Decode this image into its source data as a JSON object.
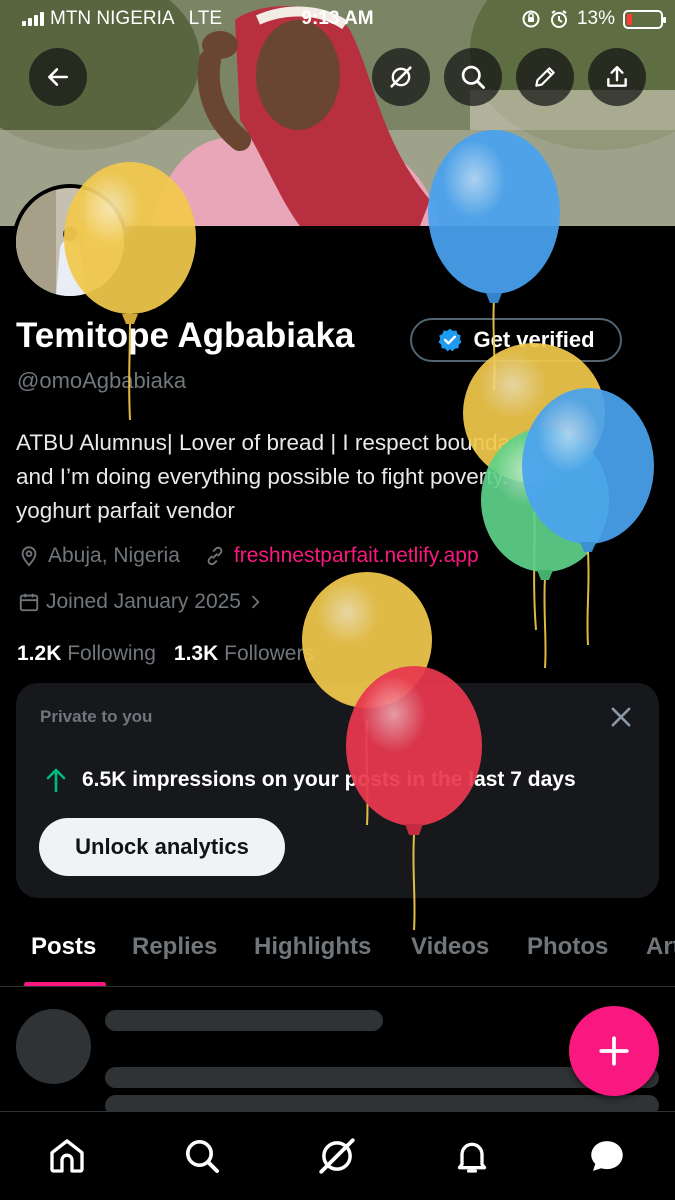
{
  "status_bar": {
    "carrier": "MTN NIGERIA",
    "network": "LTE",
    "time": "9:13 AM",
    "battery": "13%",
    "battery_level": 0.13
  },
  "profile": {
    "name": "Temitope Agbabiaka",
    "verify_label": "Get verified",
    "handle": "@omoAgbabiaka",
    "bio_lines": [
      "ATBU Alumnus| Lover of bread | I respect boundaries,",
      "and I’m doing everything possible to fight poverty.",
      "yoghurt parfait vendor"
    ],
    "location": "Abuja, Nigeria",
    "website": "freshnestparfait.netlify.app",
    "joined": "Joined January 2025",
    "following_count": "1.2K",
    "following_label": "Following",
    "followers_count": "1.3K",
    "followers_label": "Followers"
  },
  "insights": {
    "header": "Private to you",
    "impressions": "6.5K impressions on your posts in the last 7 days",
    "unlock_label": "Unlock analytics"
  },
  "tabs": [
    "Posts",
    "Replies",
    "Highlights",
    "Videos",
    "Photos",
    "Articles"
  ],
  "colors": {
    "accent": "#f91880",
    "verified": "#1d9bf0",
    "growth": "#00ba7c",
    "balloon_yellow": "#f2c94c",
    "balloon_blue": "#4aa3f0",
    "balloon_green": "#5fd38a",
    "balloon_red": "#e9384f"
  },
  "icons": {
    "back": "arrow-left-icon",
    "grok": "grok-icon",
    "search": "search-icon",
    "edit": "pencil-icon",
    "share": "share-icon",
    "location": "location-pin-icon",
    "link": "link-icon",
    "calendar": "calendar-icon",
    "close": "close-icon",
    "arrow_up": "arrow-up-icon",
    "compose": "plus-icon",
    "nav": [
      "home-icon",
      "search-icon",
      "grok-icon",
      "bell-icon",
      "messages-icon"
    ]
  }
}
